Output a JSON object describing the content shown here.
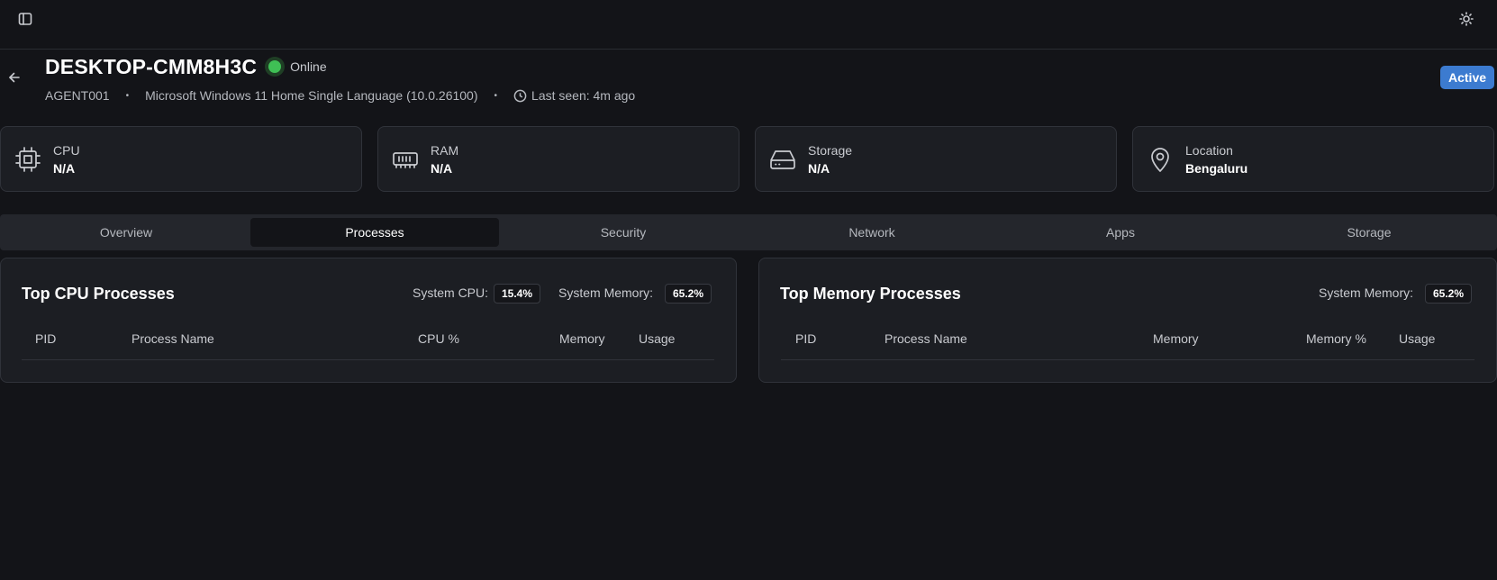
{
  "host": {
    "title": "DESKTOP-CMM8H3C",
    "status": "Online",
    "agent_id": "AGENT001",
    "os": "Microsoft Windows 11 Home Single Language (10.0.26100)",
    "last_seen": "Last seen: 4m ago",
    "badge": "Active",
    "meta_sep": "•"
  },
  "stats": [
    {
      "label": "CPU",
      "value": "N/A",
      "icon": "cpu-icon"
    },
    {
      "label": "RAM",
      "value": "N/A",
      "icon": "ram-icon"
    },
    {
      "label": "Storage",
      "value": "N/A",
      "icon": "storage-icon"
    },
    {
      "label": "Location",
      "value": "Bengaluru",
      "icon": "location-pin-icon"
    }
  ],
  "tabs": [
    "Overview",
    "Processes",
    "Security",
    "Network",
    "Apps",
    "Storage"
  ],
  "active_tab": "Processes",
  "cpu_panel": {
    "title": "Top CPU Processes",
    "system_cpu_label": "System CPU:",
    "system_cpu_value": "15.4%",
    "system_memory_label": "System Memory:",
    "system_memory_value": "65.2%",
    "columns": [
      "PID",
      "Process Name",
      "CPU %",
      "Memory",
      "Usage"
    ]
  },
  "memory_panel": {
    "title": "Top Memory Processes",
    "system_memory_label": "System Memory:",
    "system_memory_value": "65.2%",
    "columns": [
      "PID",
      "Process Name",
      "Memory",
      "Memory %",
      "Usage"
    ]
  },
  "colors": {
    "background": "#131418",
    "card": "#1c1e23",
    "accent": "#3c7bd0",
    "online": "#3fbf55"
  }
}
